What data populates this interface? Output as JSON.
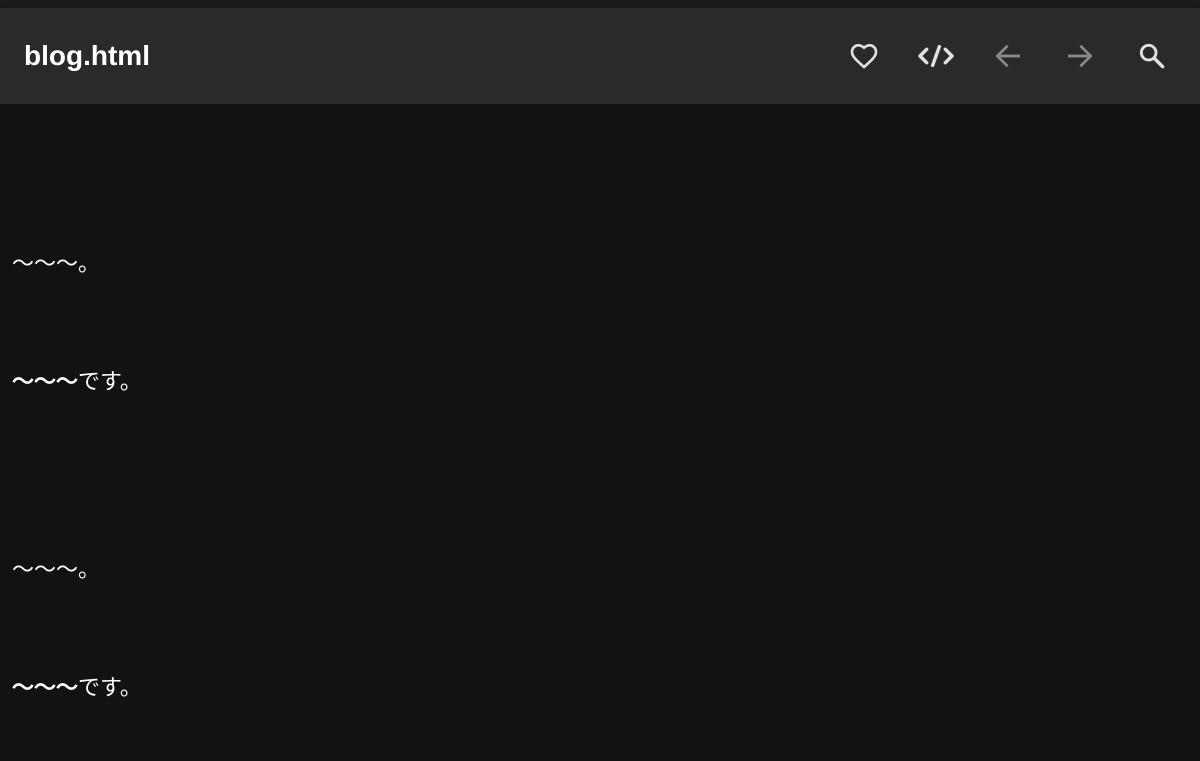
{
  "app_bar": {
    "title": "blog.html",
    "actions": [
      {
        "name": "favorite",
        "icon": "heart-outline-icon",
        "enabled": true
      },
      {
        "name": "view-source",
        "icon": "code-icon",
        "enabled": true
      },
      {
        "name": "back",
        "icon": "arrow-left-icon",
        "enabled": false
      },
      {
        "name": "forward",
        "icon": "arrow-right-icon",
        "enabled": false
      },
      {
        "name": "search",
        "icon": "search-icon",
        "enabled": true
      }
    ]
  },
  "content": {
    "blocks": [
      {
        "plain": "〜〜〜。"
      },
      {
        "bold": "〜〜〜",
        "rest": "です。"
      },
      {
        "plain": "〜〜〜。"
      },
      {
        "bold": "〜〜〜",
        "rest": "です。"
      }
    ]
  },
  "colors": {
    "background": "#121212",
    "app_bar": "#2a2a2a",
    "icon_active": "#e0e0e0",
    "icon_disabled": "#8a8a8a",
    "text": "#ffffff"
  }
}
